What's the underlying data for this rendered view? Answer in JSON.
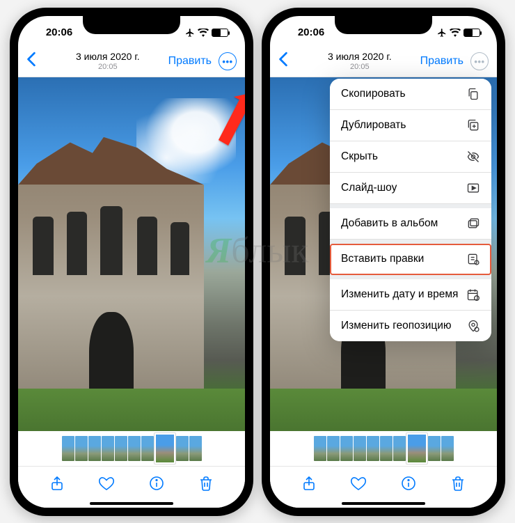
{
  "status": {
    "time": "20:06"
  },
  "nav": {
    "date": "3 июля 2020 г.",
    "time": "20:05",
    "edit": "Править"
  },
  "menu": {
    "copy": "Скопировать",
    "duplicate": "Дублировать",
    "hide": "Скрыть",
    "slideshow": "Слайд-шоу",
    "add_to_album": "Добавить в альбом",
    "paste_edits": "Вставить правки",
    "edit_datetime": "Изменить дату и время",
    "edit_location": "Изменить геопозицию"
  },
  "watermark": "Яблык"
}
